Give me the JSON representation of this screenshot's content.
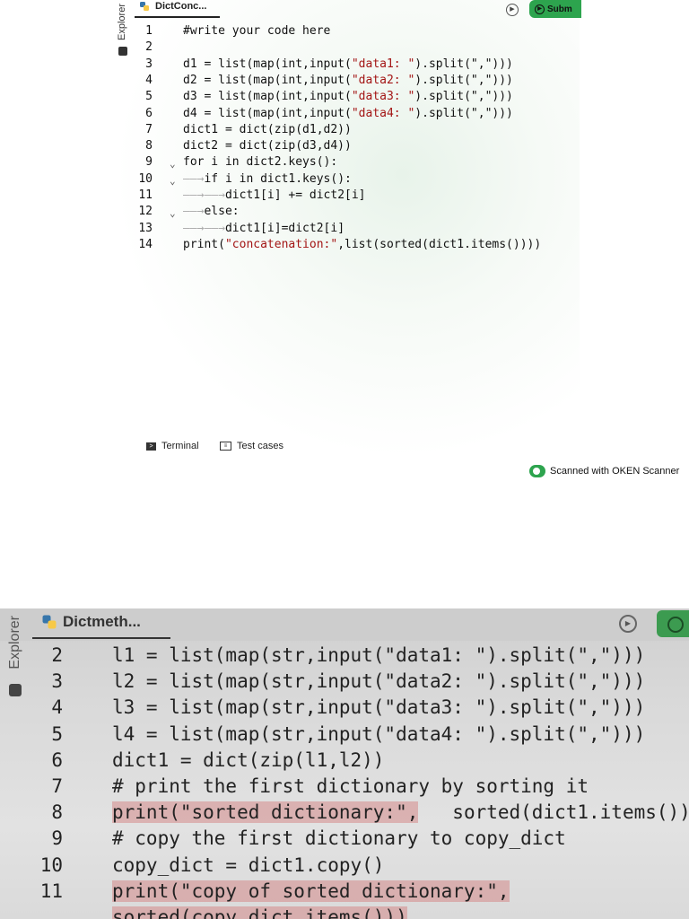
{
  "top_editor": {
    "sidebar_label": "Explorer",
    "tab_label": "DictConc...",
    "submit_label": "Subm",
    "lines": [
      {
        "n": "1",
        "parts": [
          {
            "t": "#write your code here"
          }
        ]
      },
      {
        "n": "2",
        "parts": [
          {
            "t": ""
          }
        ]
      },
      {
        "n": "3",
        "parts": [
          {
            "t": "d1 = list(map(int,input("
          },
          {
            "t": "\"data1: \"",
            "s": true
          },
          {
            "t": ").split(\",\")))"
          }
        ]
      },
      {
        "n": "4",
        "parts": [
          {
            "t": "d2 = list(map(int,input("
          },
          {
            "t": "\"data2: \"",
            "s": true
          },
          {
            "t": ").split(\",\")))"
          }
        ]
      },
      {
        "n": "5",
        "parts": [
          {
            "t": "d3 = list(map(int,input("
          },
          {
            "t": "\"data3: \"",
            "s": true
          },
          {
            "t": ").split(\",\")))"
          }
        ]
      },
      {
        "n": "6",
        "parts": [
          {
            "t": "d4 = list(map(int,input("
          },
          {
            "t": "\"data4: \"",
            "s": true
          },
          {
            "t": ").split(\",\")))"
          }
        ]
      },
      {
        "n": "7",
        "parts": [
          {
            "t": "dict1 = dict(zip(d1,d2))"
          }
        ]
      },
      {
        "n": "8",
        "parts": [
          {
            "t": "dict2 = dict(zip(d3,d4))"
          }
        ]
      },
      {
        "n": "9",
        "parts": [
          {
            "t": "for i in dict2.keys():"
          }
        ],
        "fold": true
      },
      {
        "n": "10",
        "parts": [
          {
            "t": "——→",
            "a": true
          },
          {
            "t": "if i in dict1.keys():"
          }
        ],
        "fold": true
      },
      {
        "n": "11",
        "parts": [
          {
            "t": "——→——→",
            "a": true
          },
          {
            "t": "dict1[i] += dict2[i]"
          }
        ]
      },
      {
        "n": "12",
        "parts": [
          {
            "t": "——→",
            "a": true
          },
          {
            "t": "else:"
          }
        ],
        "fold": true
      },
      {
        "n": "13",
        "parts": [
          {
            "t": "——→——→",
            "a": true
          },
          {
            "t": "dict1[i]=dict2[i]"
          }
        ]
      },
      {
        "n": "14",
        "parts": [
          {
            "t": "print("
          },
          {
            "t": "\"concatenation:\"",
            "s": true
          },
          {
            "t": ",list(sorted(dict1.items())))"
          }
        ]
      }
    ],
    "terminal_label": "Terminal",
    "testcases_label": "Test cases",
    "scanner_label": "Scanned with OKEN Scanner"
  },
  "bottom_editor": {
    "sidebar_label": "Explorer",
    "tab_label": "Dictmeth...",
    "lines": [
      {
        "n": "2",
        "parts": [
          {
            "t": "l1 = list(map(str,input(\"data1: \").split(\",\")))"
          }
        ]
      },
      {
        "n": "3",
        "parts": [
          {
            "t": "l2 = list(map(str,input(\"data2: \").split(\",\")))"
          }
        ]
      },
      {
        "n": "4",
        "parts": [
          {
            "t": "l3 = list(map(str,input(\"data3: \").split(\",\")))"
          }
        ]
      },
      {
        "n": "5",
        "parts": [
          {
            "t": "l4 = list(map(str,input(\"data4: \").split(\",\")))"
          }
        ]
      },
      {
        "n": "6",
        "parts": [
          {
            "t": "dict1 = dict(zip(l1,l2))"
          }
        ]
      },
      {
        "n": "7",
        "parts": [
          {
            "t": "# print the first dictionary by sorting it"
          }
        ]
      },
      {
        "n": "8",
        "parts": [
          {
            "t": "print(\"sorted dictionary:\",",
            "h": true
          },
          {
            "t": "   sorted(dict1.items())"
          }
        ]
      },
      {
        "n": "9",
        "parts": [
          {
            "t": "# copy the first dictionary to copy_dict"
          }
        ]
      },
      {
        "n": "10",
        "parts": [
          {
            "t": "copy_dict = dict1.copy()"
          }
        ]
      },
      {
        "n": "11",
        "parts": [
          {
            "t": "print(\"copy of sorted dictionary:\",",
            "h": true
          }
        ]
      },
      {
        "n": "",
        "parts": [
          {
            "t": "sorted(copy_dict.items()))",
            "h": true
          }
        ]
      }
    ]
  },
  "colors": {
    "accent": "#2da44e",
    "string": "#a31515",
    "highlight": "#d27878"
  }
}
